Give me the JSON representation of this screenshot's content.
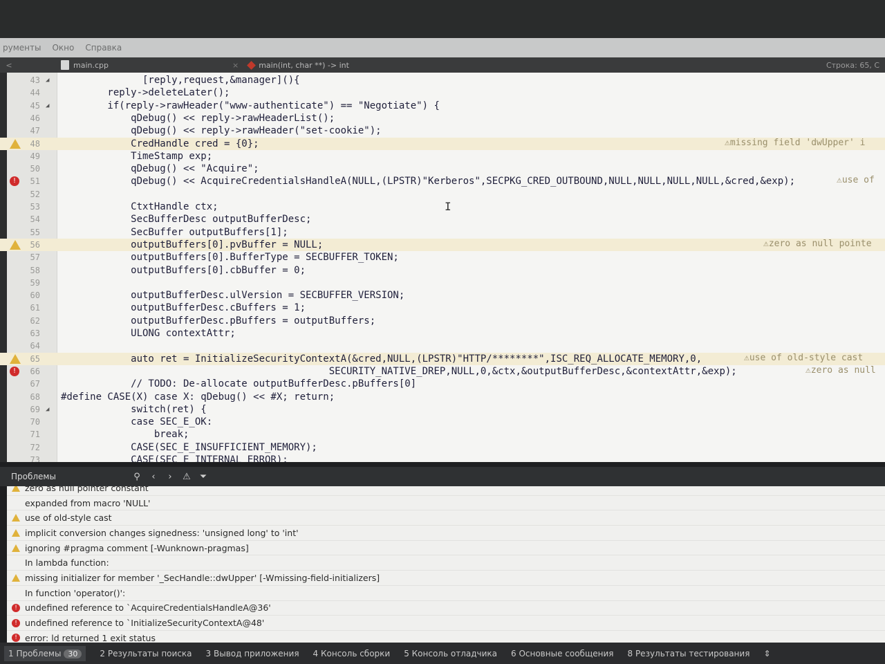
{
  "menu": [
    "рументы",
    "Окно",
    "Справка"
  ],
  "tab": {
    "back_symbol": "<",
    "file_name": "main.cpp",
    "close_symbol": "×",
    "function": "main(int, char **) -> int",
    "cursor_info": "Строка: 65, С"
  },
  "editor": {
    "lines": [
      {
        "n": "43",
        "code": "              [reply,request,&manager](){",
        "fold": true
      },
      {
        "n": "44",
        "code": "        reply->deleteLater();"
      },
      {
        "n": "45",
        "code": "        if(reply->rawHeader(\"www-authenticate\") == \"Negotiate\") {",
        "fold": true
      },
      {
        "n": "46",
        "code": "            qDebug() << reply->rawHeaderList();"
      },
      {
        "n": "47",
        "code": "            qDebug() << reply->rawHeader(\"set-cookie\");"
      },
      {
        "n": "48",
        "code": "            CredHandle cred = {0};",
        "marker": "warning",
        "highlight": true
      },
      {
        "n": "49",
        "code": "            TimeStamp exp;"
      },
      {
        "n": "50",
        "code": "            qDebug() << \"Acquire\";"
      },
      {
        "n": "51",
        "code": "            qDebug() << AcquireCredentialsHandleA(NULL,(LPSTR)\"Kerberos\",SECPKG_CRED_OUTBOUND,NULL,NULL,NULL,NULL,&cred,&exp);",
        "marker": "error"
      },
      {
        "n": "52",
        "code": ""
      },
      {
        "n": "53",
        "code": "            CtxtHandle ctx;"
      },
      {
        "n": "54",
        "code": "            SecBufferDesc outputBufferDesc;"
      },
      {
        "n": "55",
        "code": "            SecBuffer outputBuffers[1];"
      },
      {
        "n": "56",
        "code": "            outputBuffers[0].pvBuffer = NULL;",
        "marker": "warning",
        "highlight": true
      },
      {
        "n": "57",
        "code": "            outputBuffers[0].BufferType = SECBUFFER_TOKEN;"
      },
      {
        "n": "58",
        "code": "            outputBuffers[0].cbBuffer = 0;"
      },
      {
        "n": "59",
        "code": ""
      },
      {
        "n": "60",
        "code": "            outputBufferDesc.ulVersion = SECBUFFER_VERSION;"
      },
      {
        "n": "61",
        "code": "            outputBufferDesc.cBuffers = 1;"
      },
      {
        "n": "62",
        "code": "            outputBufferDesc.pBuffers = outputBuffers;"
      },
      {
        "n": "63",
        "code": "            ULONG contextAttr;"
      },
      {
        "n": "64",
        "code": ""
      },
      {
        "n": "65",
        "code": "            auto ret = InitializeSecurityContextA(&cred,NULL,(LPSTR)\"HTTP/********\",ISC_REQ_ALLOCATE_MEMORY,0,",
        "marker": "warning",
        "highlight": true
      },
      {
        "n": "66",
        "code": "                                              SECURITY_NATIVE_DREP,NULL,0,&ctx,&outputBufferDesc,&contextAttr,&exp);",
        "marker": "error"
      },
      {
        "n": "67",
        "code": "            // TODO: De-allocate outputBufferDesc.pBuffers[0]"
      },
      {
        "n": "68",
        "code": "#define CASE(X) case X: qDebug() << #X; return;"
      },
      {
        "n": "69",
        "code": "            switch(ret) {",
        "fold": true
      },
      {
        "n": "70",
        "code": "            case SEC_E_OK:"
      },
      {
        "n": "71",
        "code": "                break;"
      },
      {
        "n": "72",
        "code": "            CASE(SEC_E_INSUFFICIENT_MEMORY);"
      },
      {
        "n": "73",
        "code": "            CASE(SEC_E_INTERNAL_ERROR);"
      }
    ],
    "annotations": [
      {
        "line": "48",
        "text": "missing field 'dwUpper' i"
      },
      {
        "line": "51",
        "text": "use of"
      },
      {
        "line": "56",
        "text": "zero as null pointe"
      },
      {
        "line": "65",
        "text": "use of old-style cast"
      },
      {
        "line": "66",
        "text": "zero as null"
      }
    ]
  },
  "problems_panel": {
    "title": "Проблемы",
    "tools": [
      "filter-scope",
      "prev",
      "next",
      "warnings-toggle",
      "filter"
    ],
    "items": [
      {
        "type": "warning",
        "text": "zero as null pointer constant"
      },
      {
        "type": "none",
        "text": "expanded from macro 'NULL'"
      },
      {
        "type": "warning",
        "text": "use of old-style cast"
      },
      {
        "type": "warning",
        "text": "implicit conversion changes signedness: 'unsigned long' to 'int'"
      },
      {
        "type": "warning",
        "text": "ignoring #pragma comment  [-Wunknown-pragmas]"
      },
      {
        "type": "none",
        "text": "In lambda function:"
      },
      {
        "type": "warning",
        "text": "missing initializer for member '_SecHandle::dwUpper' [-Wmissing-field-initializers]"
      },
      {
        "type": "none",
        "text": "In function 'operator()':"
      },
      {
        "type": "error",
        "text": "undefined reference to `AcquireCredentialsHandleA@36'"
      },
      {
        "type": "error",
        "text": "undefined reference to `InitializeSecurityContextA@48'"
      },
      {
        "type": "error",
        "text": "error: ld returned 1 exit status"
      }
    ]
  },
  "statusbar": {
    "tabs": [
      {
        "label": "1  Проблемы",
        "badge": "30"
      },
      {
        "label": "2  Результаты поиска"
      },
      {
        "label": "3  Вывод приложения"
      },
      {
        "label": "4  Консоль сборки"
      },
      {
        "label": "5  Консоль отладчика"
      },
      {
        "label": "6  Основные сообщения"
      },
      {
        "label": "8  Результаты тестирования"
      }
    ],
    "more_symbol": "⇕"
  },
  "colors": {
    "warning": "#e0b23b",
    "error": "#d02b2b",
    "editor_bg": "#f5f5f3",
    "panel_bg": "#f0f0ee"
  }
}
